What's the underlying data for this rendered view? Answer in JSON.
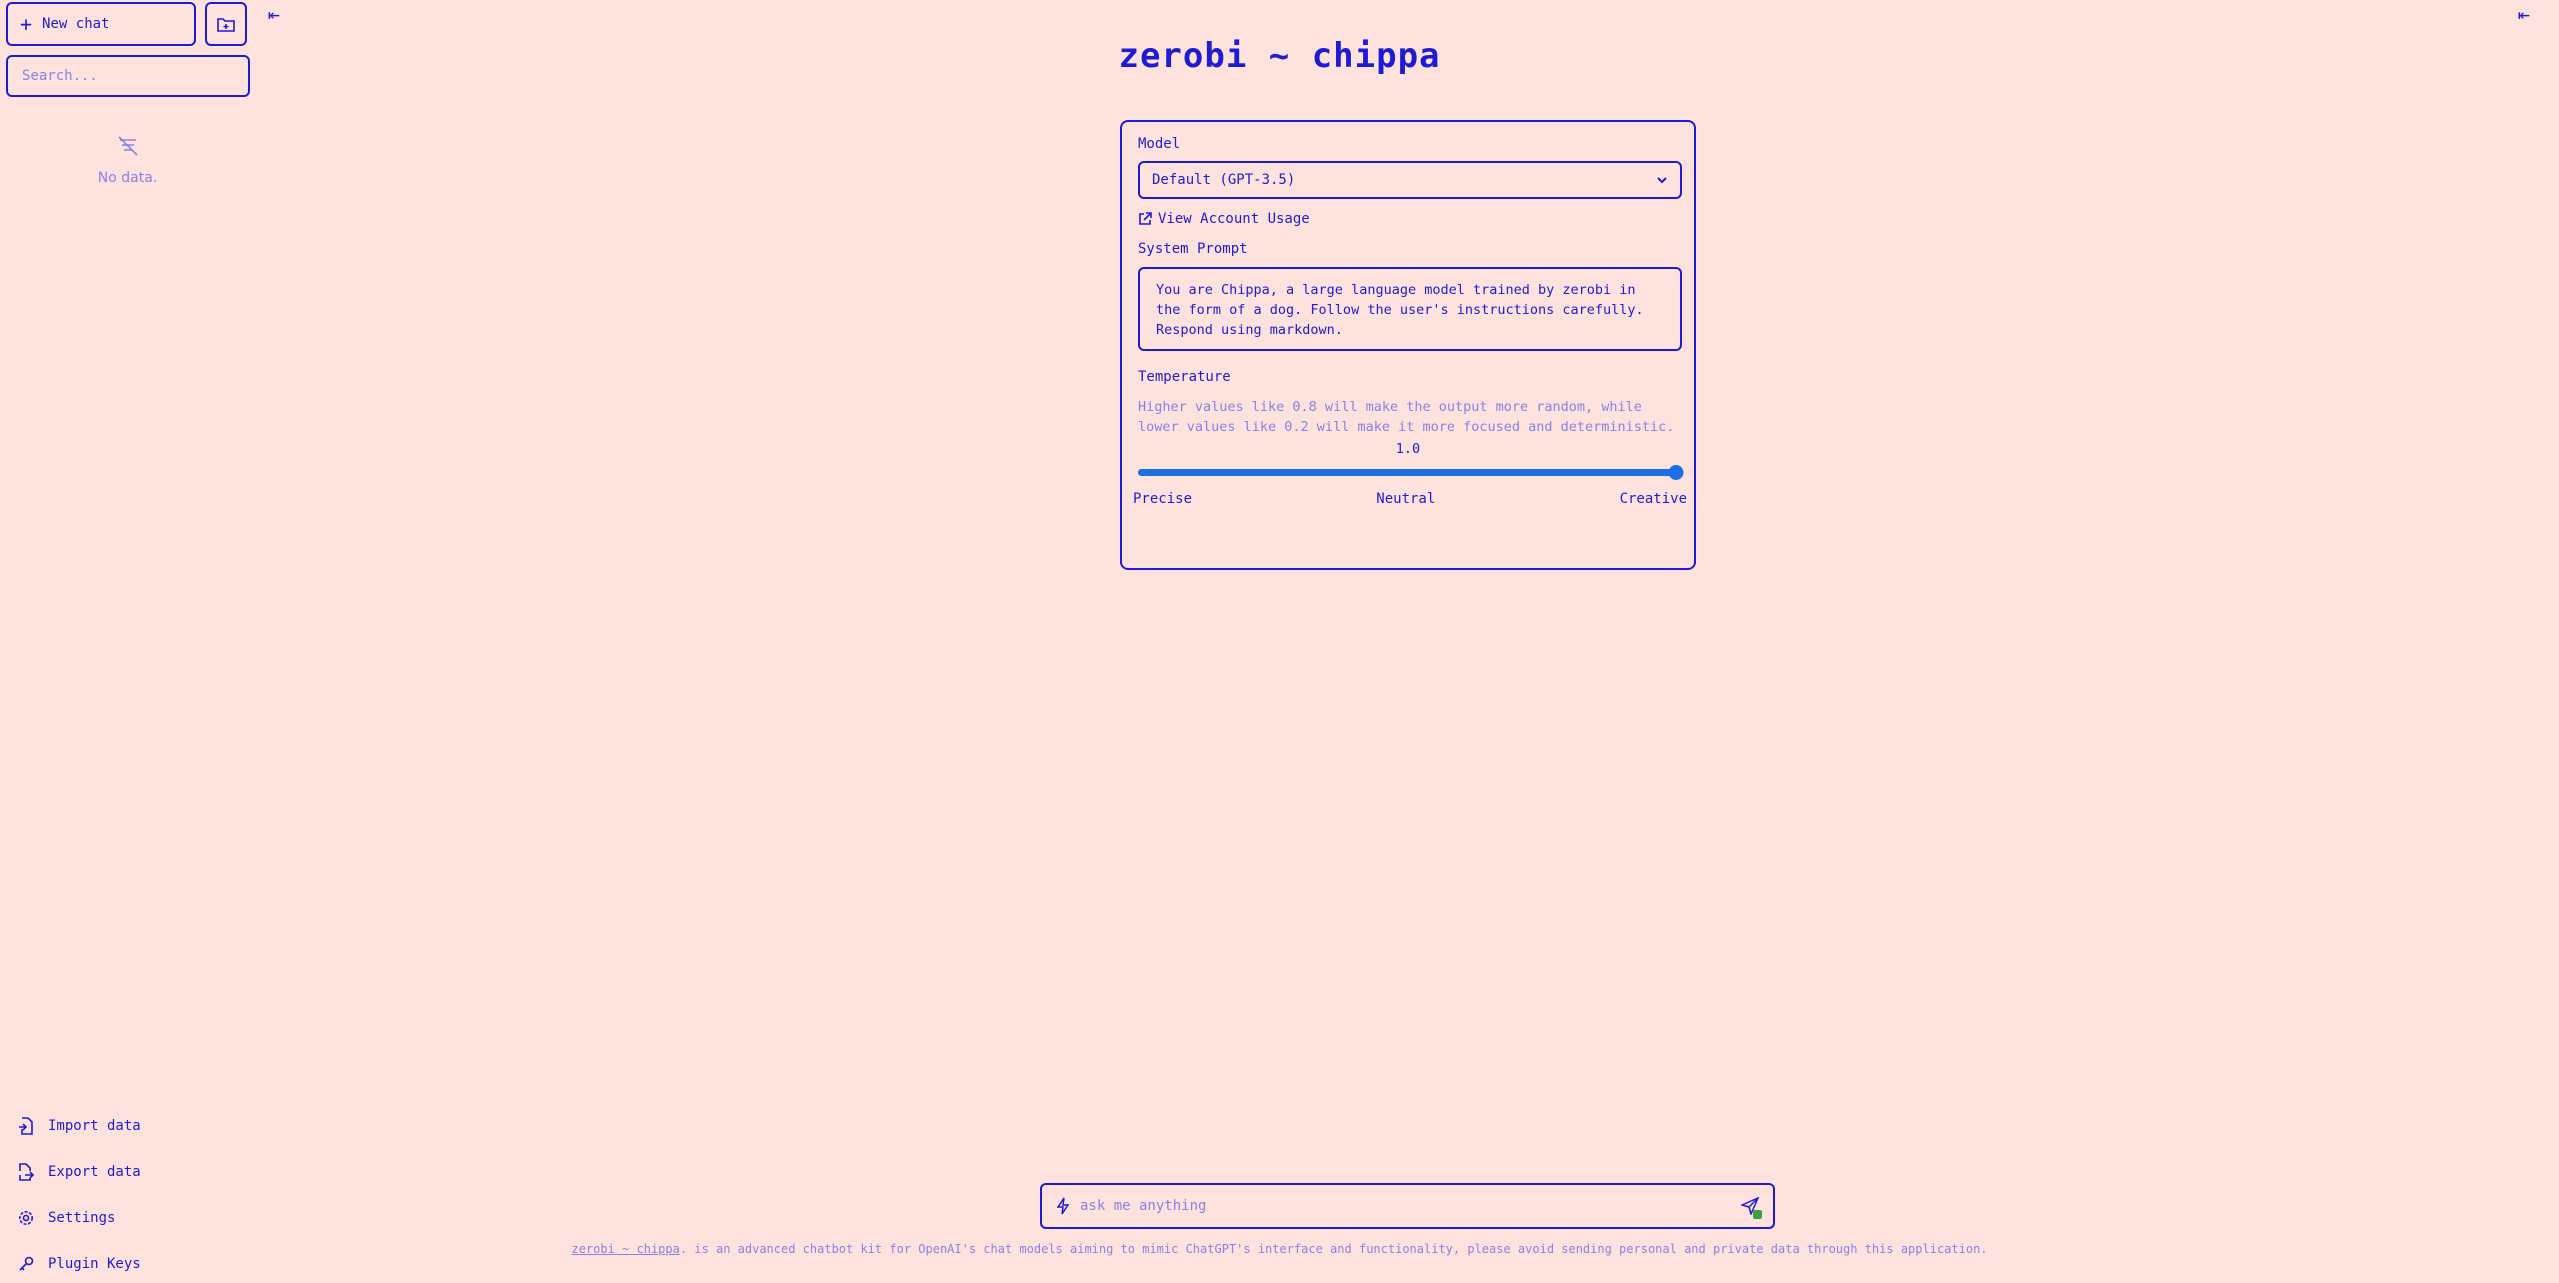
{
  "sidebar": {
    "new_chat_label": "New chat",
    "search_placeholder": "Search...",
    "empty_text": "No data.",
    "menu": [
      {
        "label": "Import data",
        "icon": "file-import-icon"
      },
      {
        "label": "Export data",
        "icon": "file-export-icon"
      },
      {
        "label": "Settings",
        "icon": "gear-icon"
      },
      {
        "label": "Plugin Keys",
        "icon": "key-icon"
      }
    ]
  },
  "main": {
    "title": "zerobi ~ chippa",
    "model_label": "Model",
    "model_value": "Default (GPT-3.5)",
    "usage_link": "View Account Usage",
    "system_prompt_label": "System Prompt",
    "system_prompt": "You are Chippa, a large language model trained by zerobi in the form of a dog. Follow the user's instructions carefully. Respond using markdown.",
    "temperature_label": "Temperature",
    "temperature_desc": "Higher values like 0.8 will make the output more random, while lower values like 0.2 will make it more focused and deterministic.",
    "temperature_value": "1.0",
    "temperature_fraction": 1.0,
    "scale": {
      "left": "Precise",
      "middle": "Neutral",
      "right": "Creative"
    }
  },
  "input": {
    "placeholder": "ask me anything"
  },
  "footer": {
    "link_text": "zerobi ~ chippa",
    "text": ". is an advanced chatbot kit for OpenAI's chat models aiming to mimic ChatGPT's interface and functionality, please avoid sending personal and private data through this application."
  },
  "colors": {
    "background": "#fee2dd",
    "foreground": "#1e1bd6",
    "muted": "#8a82e6",
    "accent": "#1a6fe6"
  }
}
